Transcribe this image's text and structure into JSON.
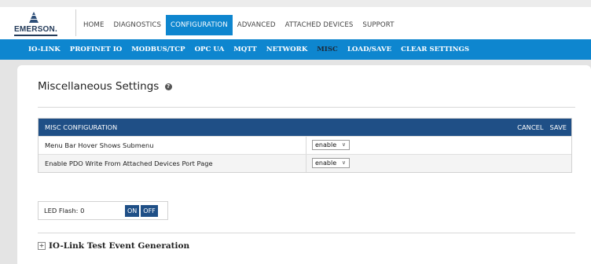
{
  "brand": {
    "name": "EMERSON."
  },
  "top_nav": [
    {
      "label": "HOME",
      "active": false
    },
    {
      "label": "DIAGNOSTICS",
      "active": false
    },
    {
      "label": "CONFIGURATION",
      "active": true
    },
    {
      "label": "ADVANCED",
      "active": false
    },
    {
      "label": "ATTACHED DEVICES",
      "active": false
    },
    {
      "label": "SUPPORT",
      "active": false
    }
  ],
  "sub_nav": [
    {
      "label": "IO-LINK",
      "active": false
    },
    {
      "label": "PROFINET IO",
      "active": false
    },
    {
      "label": "MODBUS/TCP",
      "active": false
    },
    {
      "label": "OPC UA",
      "active": false
    },
    {
      "label": "MQTT",
      "active": false
    },
    {
      "label": "NETWORK",
      "active": false
    },
    {
      "label": "MISC",
      "active": true
    },
    {
      "label": "LOAD/SAVE",
      "active": false
    },
    {
      "label": "CLEAR SETTINGS",
      "active": false
    }
  ],
  "page": {
    "title": "Miscellaneous Settings"
  },
  "misc_table": {
    "title": "MISC CONFIGURATION",
    "cancel_label": "CANCEL",
    "save_label": "SAVE",
    "rows": [
      {
        "label": "Menu Bar Hover Shows Submenu",
        "value": "enable"
      },
      {
        "label": "Enable PDO Write From Attached Devices Port Page",
        "value": "enable"
      }
    ]
  },
  "led": {
    "label": "LED Flash: 0",
    "on_label": "ON",
    "off_label": "OFF"
  },
  "section": {
    "title": "IO-Link Test Event Generation"
  },
  "colors": {
    "nav_blue": "#0e86cf",
    "header_navy": "#1f4f86",
    "background": "#e4e4e4"
  }
}
